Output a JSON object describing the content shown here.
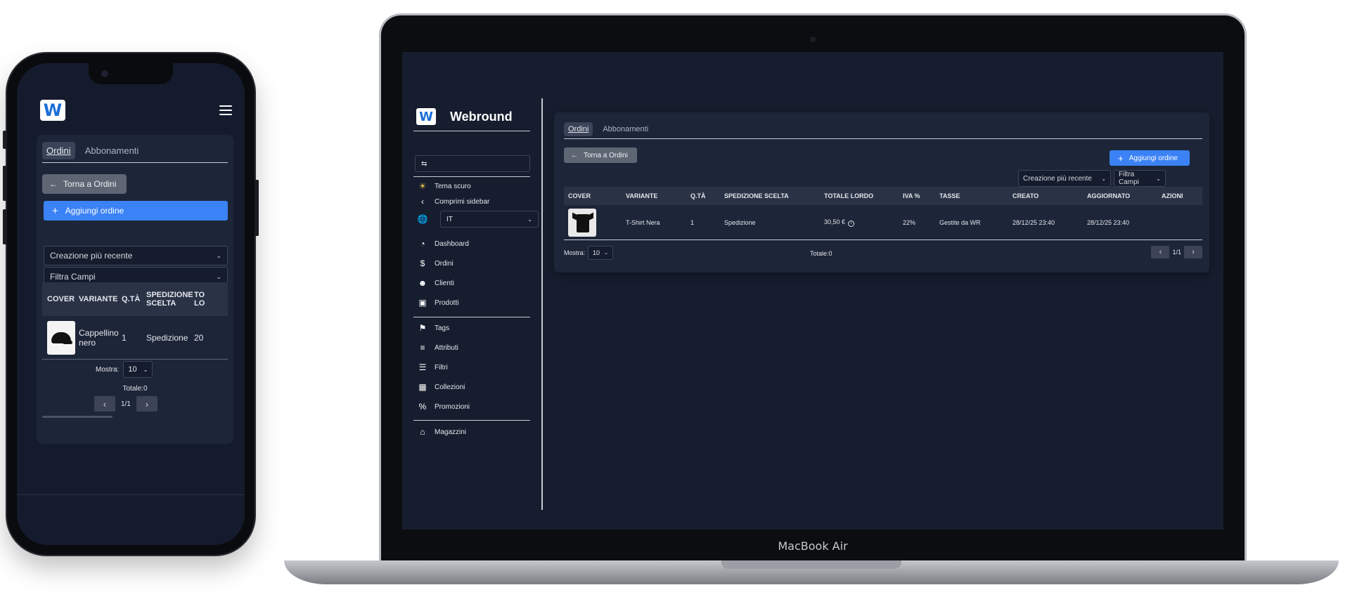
{
  "phone": {
    "logo_letter": "W",
    "tabs": [
      {
        "label": "Ordini",
        "active": true
      },
      {
        "label": "Abbonamenti",
        "active": false
      }
    ],
    "back_label": "Torna a Ordini",
    "add_label": "Aggiungi ordine",
    "sort_value": "Creazione più recente",
    "filter_value": "Filtra Campi",
    "columns": [
      "COVER",
      "VARIANTE",
      "Q.TÀ",
      "SPEDIZIONE SCELTA",
      "TO LO"
    ],
    "row": {
      "variant": "Cappellino nero",
      "qty": "1",
      "shipping": "Spedizione",
      "total": "20"
    },
    "show_label": "Mostra:",
    "show_value": "10",
    "total_label": "Totale:0",
    "page": "1/1"
  },
  "laptop": {
    "model_label": "MacBook Air",
    "brand": "Webround",
    "logo_letter": "W",
    "sidebar": {
      "theme_label": "Tema scuro",
      "collapse_label": "Comprimi sidebar",
      "language": "IT",
      "nav_primary": [
        "Dashboard",
        "Ordini",
        "Clienti",
        "Prodotti"
      ],
      "nav_secondary": [
        "Tags",
        "Attributi",
        "Filtri",
        "Collezioni",
        "Promozioni"
      ],
      "nav_tertiary": [
        "Magazzini"
      ]
    },
    "tabs": [
      {
        "label": "Ordini",
        "active": true
      },
      {
        "label": "Abbonamenti",
        "active": false
      }
    ],
    "back_label": "Torna a Ordini",
    "add_label": "Aggiungi ordine",
    "sort_value": "Creazione più recente",
    "filter_value": "Filtra Campi",
    "columns": [
      "COVER",
      "VARIANTE",
      "Q.TÀ",
      "SPEDIZIONE SCELTA",
      "TOTALE LORDO",
      "IVA %",
      "TASSE",
      "CREATO",
      "AGGIORNATO",
      "AZIONI"
    ],
    "row": {
      "variant": "T-Shirt Nera",
      "qty": "1",
      "shipping": "Spedizione",
      "total": "30,50 €",
      "vat": "22%",
      "taxes": "Gestite da WR",
      "created": "28/12/25 23:40",
      "updated": "28/12/25 23:40"
    },
    "show_label": "Mostra:",
    "show_value": "10",
    "total_label": "Totale:0",
    "page": "1/1"
  },
  "colors": {
    "accent": "#3b82f6",
    "panel": "#1d2538",
    "background": "#161d2e"
  }
}
